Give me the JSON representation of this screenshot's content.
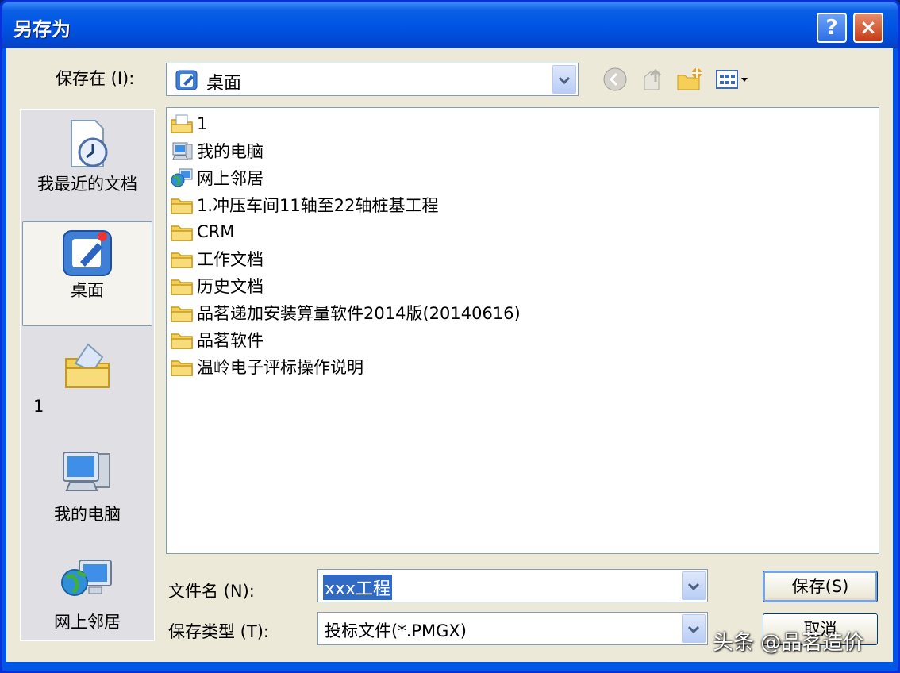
{
  "window": {
    "title": "另存为",
    "help_label": "?",
    "close_label": "×"
  },
  "save_in": {
    "label": "保存在 (I):",
    "value": "桌面"
  },
  "places": [
    {
      "label": "我最近的文档",
      "icon": "recent-documents-icon"
    },
    {
      "label": "桌面",
      "icon": "desktop-icon",
      "selected": true
    },
    {
      "label": "1",
      "icon": "user-folder-icon"
    },
    {
      "label": "我的电脑",
      "icon": "my-computer-icon"
    },
    {
      "label": "网上邻居",
      "icon": "network-places-icon"
    }
  ],
  "files": [
    {
      "name": "1",
      "icon": "user-folder-icon"
    },
    {
      "name": "我的电脑",
      "icon": "my-computer-icon"
    },
    {
      "name": "网上邻居",
      "icon": "network-places-icon"
    },
    {
      "name": "1.冲压车间11轴至22轴桩基工程",
      "icon": "folder-icon"
    },
    {
      "name": "CRM",
      "icon": "folder-icon"
    },
    {
      "name": "工作文档",
      "icon": "folder-icon"
    },
    {
      "name": "历史文档",
      "icon": "folder-icon"
    },
    {
      "name": "品茗递加安装算量软件2014版(20140616)",
      "icon": "folder-icon"
    },
    {
      "name": "品茗软件",
      "icon": "folder-icon"
    },
    {
      "name": "温岭电子评标操作说明",
      "icon": "folder-icon"
    }
  ],
  "filename": {
    "label": "文件名 (N):",
    "value": "xxx工程"
  },
  "filetype": {
    "label": "保存类型 (T):",
    "value": "投标文件(*.PMGX)"
  },
  "buttons": {
    "save": "保存(S)",
    "cancel": "取消"
  },
  "watermark": "头条 @品茗造价",
  "colors": {
    "titlebar": "#0055e5",
    "dialog_bg": "#ece9d8",
    "selection": "#316ac5",
    "folder": "#f4c95d"
  }
}
